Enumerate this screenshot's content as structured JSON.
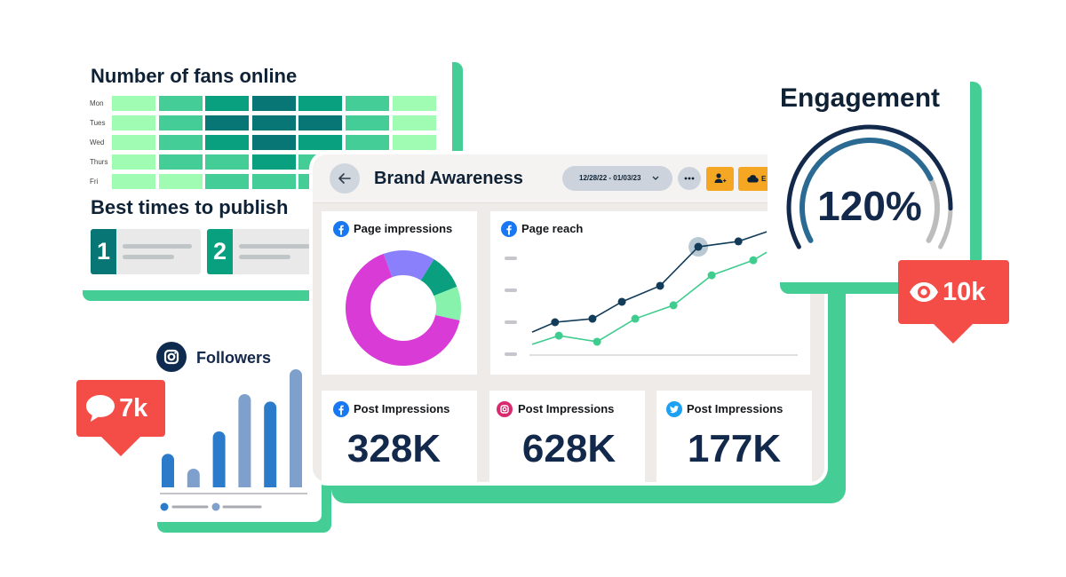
{
  "fans_card": {
    "title": "Number of fans online"
  },
  "publish_card": {
    "title": "Best times to publish",
    "items": [
      {
        "rank": "1",
        "color": "#077674"
      },
      {
        "rank": "2",
        "color": "#08a07f"
      }
    ]
  },
  "followers_card": {
    "title": "Followers",
    "icon": "instagram-icon"
  },
  "comments_badge": {
    "icon": "speech-bubble-icon",
    "value": "7k"
  },
  "views_badge": {
    "icon": "eye-icon",
    "value": "10k"
  },
  "engagement_card": {
    "title": "Engagement",
    "value_label": "120%",
    "outer_ring_progress": 0.88,
    "inner_ring_progress": 0.77,
    "outer_ring_color": "#13294b",
    "inner_ring_color": "#2a6a93",
    "track_color": "#bdbdbd"
  },
  "dashboard": {
    "title": "Brand Awareness",
    "back_icon": "arrow-left-icon",
    "date_range": "12/28/22 - 01/03/23",
    "date_chevron_icon": "chevron-down-icon",
    "more_icon": "ellipsis-icon",
    "actions": [
      {
        "icon": "add-user-icon",
        "label": ""
      },
      {
        "icon": "cloud-icon",
        "label": "E"
      }
    ],
    "widgets": {
      "page_impressions": {
        "title": "Page impressions",
        "platform": "facebook"
      },
      "page_reach": {
        "title": "Page reach",
        "platform": "facebook"
      }
    },
    "stats": [
      {
        "platform": "facebook",
        "label": "Post Impressions",
        "value": "328K"
      },
      {
        "platform": "instagram",
        "label": "Post Impressions",
        "value": "628K"
      },
      {
        "platform": "twitter",
        "label": "Post Impressions",
        "value": "177K"
      }
    ]
  },
  "colors": {
    "accent_green": "#45cd96",
    "navy": "#0f2235",
    "badge_red": "#f44c46",
    "action_orange": "#f5a623",
    "facebook": "#1877f2",
    "instagram": "#d82a6e",
    "twitter": "#1da1f2"
  },
  "chart_data": [
    {
      "key": "fans_heatmap",
      "type": "heatmap",
      "title": "Number of fans online",
      "rows": [
        "Mon",
        "Tues",
        "Wed",
        "Thurs",
        "Fri"
      ],
      "columns": 7,
      "values": [
        [
          1,
          2,
          3,
          4,
          3,
          2,
          1
        ],
        [
          1,
          2,
          4,
          4,
          4,
          2,
          1
        ],
        [
          1,
          2,
          3,
          4,
          3,
          2,
          1
        ],
        [
          1,
          2,
          2,
          3,
          2,
          null,
          null
        ],
        [
          1,
          1,
          2,
          2,
          2,
          null,
          null
        ]
      ],
      "level_colors": [
        "#a0fcb2",
        "#44cd96",
        "#08a07f",
        "#077674"
      ]
    },
    {
      "key": "followers_bars",
      "type": "bar",
      "title": "Followers",
      "values": [
        27,
        15,
        45,
        75,
        69,
        95
      ],
      "ylim": [
        0,
        100
      ],
      "bar_colors": [
        "#2b7bca",
        "#7f9fcc",
        "#2b7bca",
        "#7f9fcc",
        "#2b7bca",
        "#7f9fcc"
      ],
      "legend": [
        {
          "color": "#2b7bca"
        },
        {
          "color": "#7f9fcc"
        }
      ]
    },
    {
      "key": "page_impressions_donut",
      "type": "pie",
      "title": "Page impressions",
      "donut": true,
      "values": [
        14.5,
        10,
        9.5,
        66
      ],
      "colors": [
        "#8a80fb",
        "#0aa07f",
        "#86f2ac",
        "#d93bd6"
      ]
    },
    {
      "key": "page_reach_line",
      "type": "line",
      "title": "Page reach",
      "xlim": [
        0,
        7
      ],
      "ylim": [
        0,
        3
      ],
      "y_ticks": [
        0,
        1,
        2,
        3
      ],
      "grid": false,
      "series": [
        {
          "name": "series-1",
          "color": "#123c5a",
          "x": [
            0.07,
            0.67,
            1.65,
            2.42,
            3.42,
            4.42,
            5.47,
            6.21
          ],
          "y": [
            0.69,
            1.0,
            1.11,
            1.64,
            2.14,
            3.36,
            3.53,
            3.83
          ],
          "markers": [
            false,
            true,
            true,
            true,
            true,
            true,
            true,
            false
          ]
        },
        {
          "name": "series-2",
          "color": "#3fcc8f",
          "x": [
            0.07,
            0.77,
            1.77,
            2.77,
            3.77,
            4.77,
            5.86,
            6.21
          ],
          "y": [
            0.31,
            0.58,
            0.39,
            1.11,
            1.53,
            2.47,
            2.94,
            3.19
          ],
          "markers": [
            false,
            true,
            true,
            true,
            true,
            true,
            true,
            false
          ]
        }
      ],
      "highlight": {
        "series": 0,
        "index": 5,
        "color": "#b9c9d3"
      }
    }
  ]
}
